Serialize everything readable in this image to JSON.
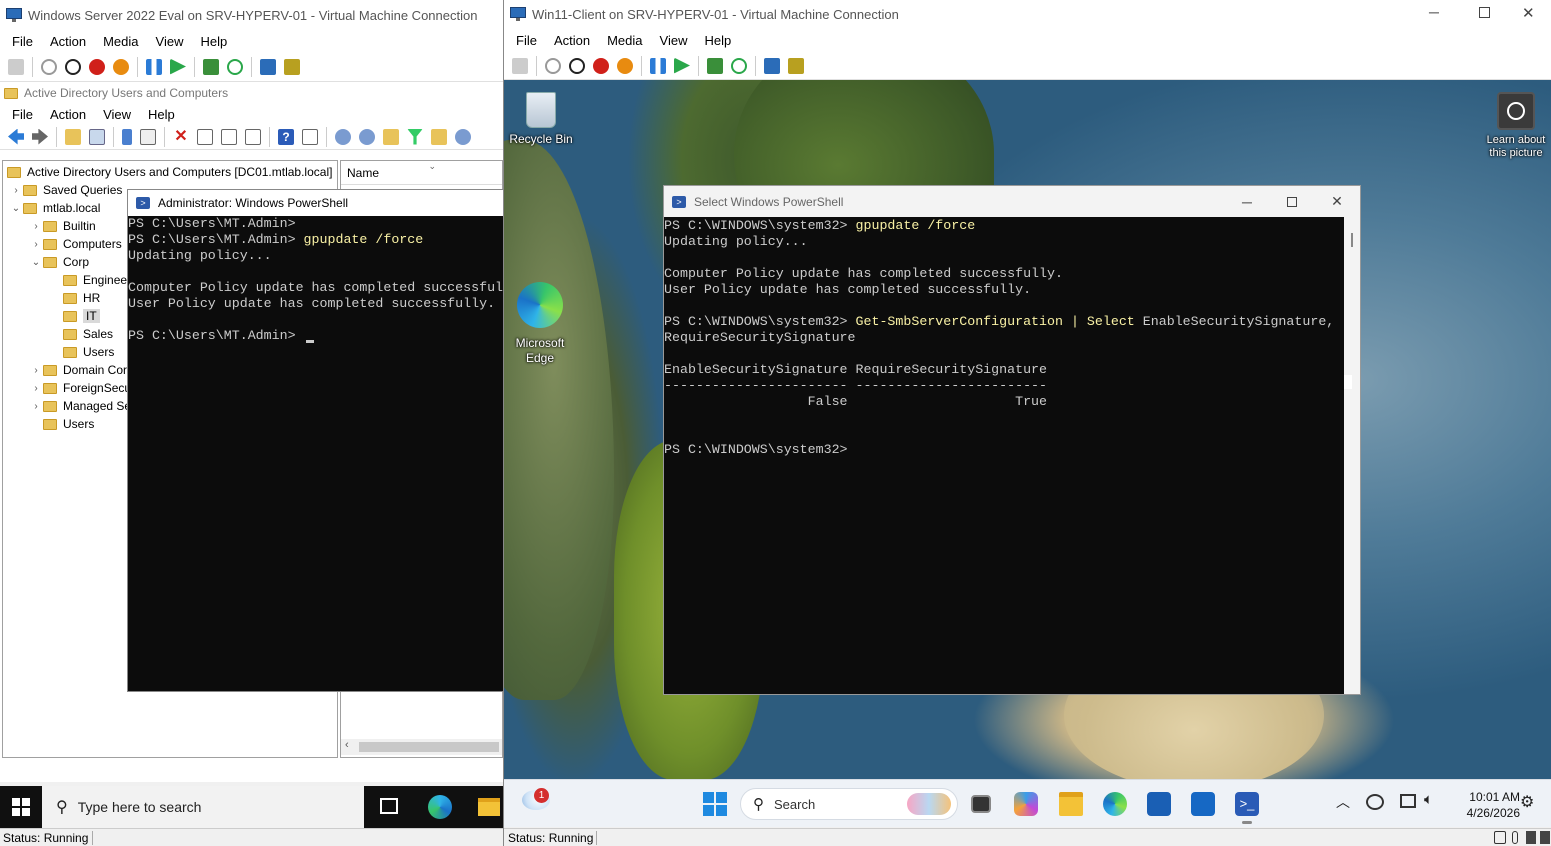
{
  "left_vm": {
    "title": "Windows Server 2022 Eval on SRV-HYPERV-01 - Virtual Machine Connection",
    "menu": [
      "File",
      "Action",
      "Media",
      "View",
      "Help"
    ],
    "status": "Status: Running"
  },
  "aduc": {
    "title": "Active Directory Users and Computers",
    "menu": [
      "File",
      "Action",
      "View",
      "Help"
    ],
    "tree_root": "Active Directory Users and Computers [DC01.mtlab.local]",
    "tree": [
      {
        "label": "Saved Queries",
        "level": 1,
        "arrow": ">"
      },
      {
        "label": "mtlab.local",
        "level": 1,
        "arrow": "v"
      },
      {
        "label": "Builtin",
        "level": 2,
        "arrow": ">"
      },
      {
        "label": "Computers",
        "level": 2,
        "arrow": ">"
      },
      {
        "label": "Corp",
        "level": 2,
        "arrow": "v"
      },
      {
        "label": "Enginee",
        "level": 3,
        "arrow": ""
      },
      {
        "label": "HR",
        "level": 3,
        "arrow": ""
      },
      {
        "label": "IT",
        "level": 3,
        "arrow": ""
      },
      {
        "label": "Sales",
        "level": 3,
        "arrow": ""
      },
      {
        "label": "Users",
        "level": 3,
        "arrow": ""
      },
      {
        "label": "Domain Cor",
        "level": 2,
        "arrow": ">"
      },
      {
        "label": "ForeignSecu",
        "level": 2,
        "arrow": ">"
      },
      {
        "label": "Managed Se",
        "level": 2,
        "arrow": ">"
      },
      {
        "label": "Users",
        "level": 2,
        "arrow": ""
      }
    ],
    "column_name": "Name"
  },
  "ps_left": {
    "title": "Administrator: Windows PowerShell",
    "lines": [
      {
        "prompt": "PS C:\\Users\\MT.Admin>",
        "cmd": ""
      },
      {
        "prompt": "PS C:\\Users\\MT.Admin>",
        "cmd": " gpupdate /force"
      },
      {
        "prompt": "Updating policy...",
        "cmd": ""
      },
      {
        "prompt": "",
        "cmd": ""
      },
      {
        "prompt": "Computer Policy update has completed successful",
        "cmd": ""
      },
      {
        "prompt": "User Policy update has completed successfully.",
        "cmd": ""
      },
      {
        "prompt": "",
        "cmd": ""
      },
      {
        "prompt": "PS C:\\Users\\MT.Admin>",
        "cmd": ""
      }
    ]
  },
  "left_taskbar": {
    "search_placeholder": "Type here to search"
  },
  "right_vm": {
    "title": "Win11-Client on SRV-HYPERV-01 - Virtual Machine Connection",
    "menu": [
      "File",
      "Action",
      "Media",
      "View",
      "Help"
    ],
    "status": "Status: Running"
  },
  "desktop": {
    "recycle_bin": "Recycle Bin",
    "edge_line1": "Microsoft",
    "edge_line2": "Edge",
    "learn_line1": "Learn about",
    "learn_line2": "this picture"
  },
  "ps_right": {
    "title": "Select Windows PowerShell",
    "lines": [
      {
        "prompt": "PS C:\\WINDOWS\\system32>",
        "cmd": " gpupdate /force",
        "rest": ""
      },
      {
        "prompt": "Updating policy...",
        "cmd": "",
        "rest": ""
      },
      {
        "prompt": "",
        "cmd": "",
        "rest": ""
      },
      {
        "prompt": "Computer Policy update has completed successfully.",
        "cmd": "",
        "rest": ""
      },
      {
        "prompt": "User Policy update has completed successfully.",
        "cmd": "",
        "rest": ""
      },
      {
        "prompt": "",
        "cmd": "",
        "rest": ""
      },
      {
        "prompt": "PS C:\\WINDOWS\\system32>",
        "cmd": " Get-SmbServerConfiguration | Select",
        "rest": " EnableSecuritySignature,"
      },
      {
        "prompt": "RequireSecuritySignature",
        "cmd": "",
        "rest": ""
      },
      {
        "prompt": "",
        "cmd": "",
        "rest": ""
      },
      {
        "prompt": "EnableSecuritySignature RequireSecuritySignature",
        "cmd": "",
        "rest": ""
      },
      {
        "prompt": "----------------------- ------------------------",
        "cmd": "",
        "rest": ""
      },
      {
        "prompt": "                  False                     True",
        "cmd": "",
        "rest": ""
      },
      {
        "prompt": "",
        "cmd": "",
        "rest": ""
      },
      {
        "prompt": "",
        "cmd": "",
        "rest": ""
      },
      {
        "prompt": "PS C:\\WINDOWS\\system32>",
        "cmd": "",
        "rest": ""
      }
    ]
  },
  "win11_taskbar": {
    "search": "Search",
    "weather_badge": "1",
    "time": "10:01 AM",
    "date": "4/26/2026"
  }
}
